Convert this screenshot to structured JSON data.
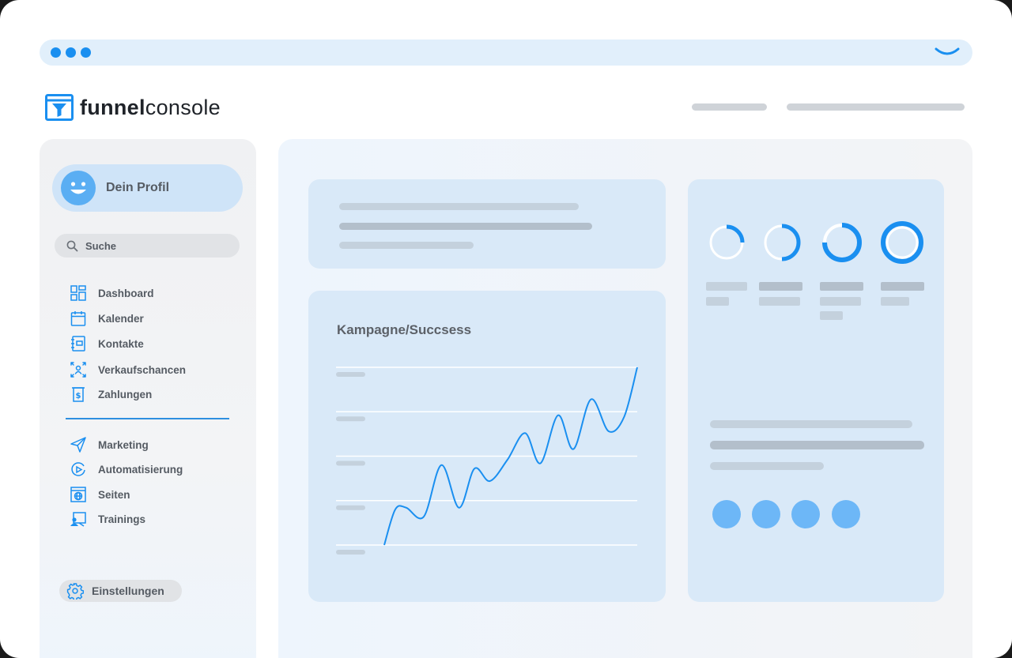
{
  "app": {
    "logo_bold": "funnel",
    "logo_light": "console",
    "accent_color": "#1a8ff0"
  },
  "sidebar": {
    "profile_label": "Dein Profil",
    "search_label": "Suche",
    "primary_items": [
      {
        "label": "Dashboard",
        "icon": "dashboard-grid-icon"
      },
      {
        "label": "Kalender",
        "icon": "calendar-icon"
      },
      {
        "label": "Kontakte",
        "icon": "contacts-book-icon"
      },
      {
        "label": "Verkaufschancen",
        "icon": "opportunities-icon"
      },
      {
        "label": "Zahlungen",
        "icon": "payments-icon"
      }
    ],
    "secondary_items": [
      {
        "label": "Marketing",
        "icon": "paper-plane-icon"
      },
      {
        "label": "Automatisierung",
        "icon": "automation-play-icon"
      },
      {
        "label": "Seiten",
        "icon": "pages-globe-icon"
      },
      {
        "label": "Trainings",
        "icon": "training-icon"
      }
    ],
    "settings_label": "Einstellungen"
  },
  "main": {
    "chart_card_title": "Kampagne/Succsess"
  },
  "chart_data": {
    "type": "line",
    "title": "Kampagne/Succsess",
    "xlabel": "",
    "ylabel": "",
    "x": [
      0,
      0.5,
      1,
      1.8,
      2.6,
      3.4,
      4.1,
      4.8,
      5.6,
      6.4,
      7.1,
      7.9,
      8.6,
      9.4,
      10.2,
      10.9,
      11.5
    ],
    "series": [
      {
        "values": [
          0,
          10,
          10.5,
          8,
          22.5,
          10.5,
          21.5,
          18,
          24,
          31.5,
          23,
          36.5,
          27,
          41,
          32,
          36,
          50
        ]
      }
    ],
    "ylim": [
      0,
      50
    ],
    "grid": true,
    "color": "#1a8ff0"
  }
}
